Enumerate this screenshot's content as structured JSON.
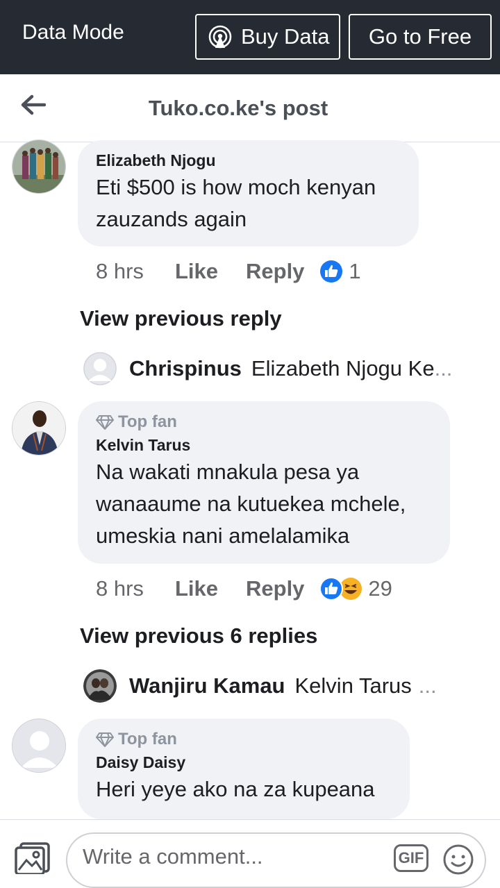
{
  "topbar": {
    "mode_label": "Data Mode",
    "buy_label": "Buy Data",
    "free_label": "Go to Free"
  },
  "header": {
    "title": "Tuko.co.ke's post"
  },
  "comments": [
    {
      "author": "Elizabeth Njogu",
      "text_lines": [
        "Eti $500 is how moch kenyan",
        "zauzands again"
      ],
      "time": "8 hrs",
      "like": "Like",
      "reply": "Reply",
      "reaction_count": "1",
      "view_previous": "View previous reply",
      "latest_reply": {
        "author": "Chrispinus",
        "excerpt": "Elizabeth Njogu Ke",
        "ellipsis": "..."
      }
    },
    {
      "badge": "Top fan",
      "author": "Kelvin Tarus",
      "text_lines": [
        "Na wakati mnakula pesa ya",
        "wanaaume na kutuekea mchele,",
        "umeskia nani amelalamika"
      ],
      "time": "8 hrs",
      "like": "Like",
      "reply": "Reply",
      "reaction_count": "29",
      "view_previous": "View previous 6 replies",
      "latest_reply": {
        "author": "Wanjiru Kamau",
        "excerpt": "Kelvin Tarus",
        "ellipsis": "..."
      }
    },
    {
      "badge": "Top fan",
      "author": "Daisy Daisy",
      "text_lines": [
        "Heri yeye ako na za kupeana"
      ]
    }
  ],
  "composer": {
    "placeholder": "Write a comment...",
    "gif_label": "GIF"
  },
  "colors": {
    "topbar": "#252a33",
    "like_blue": "#1877f2",
    "haha_yellow": "#f7b125",
    "bubble": "#f0f2f5"
  }
}
